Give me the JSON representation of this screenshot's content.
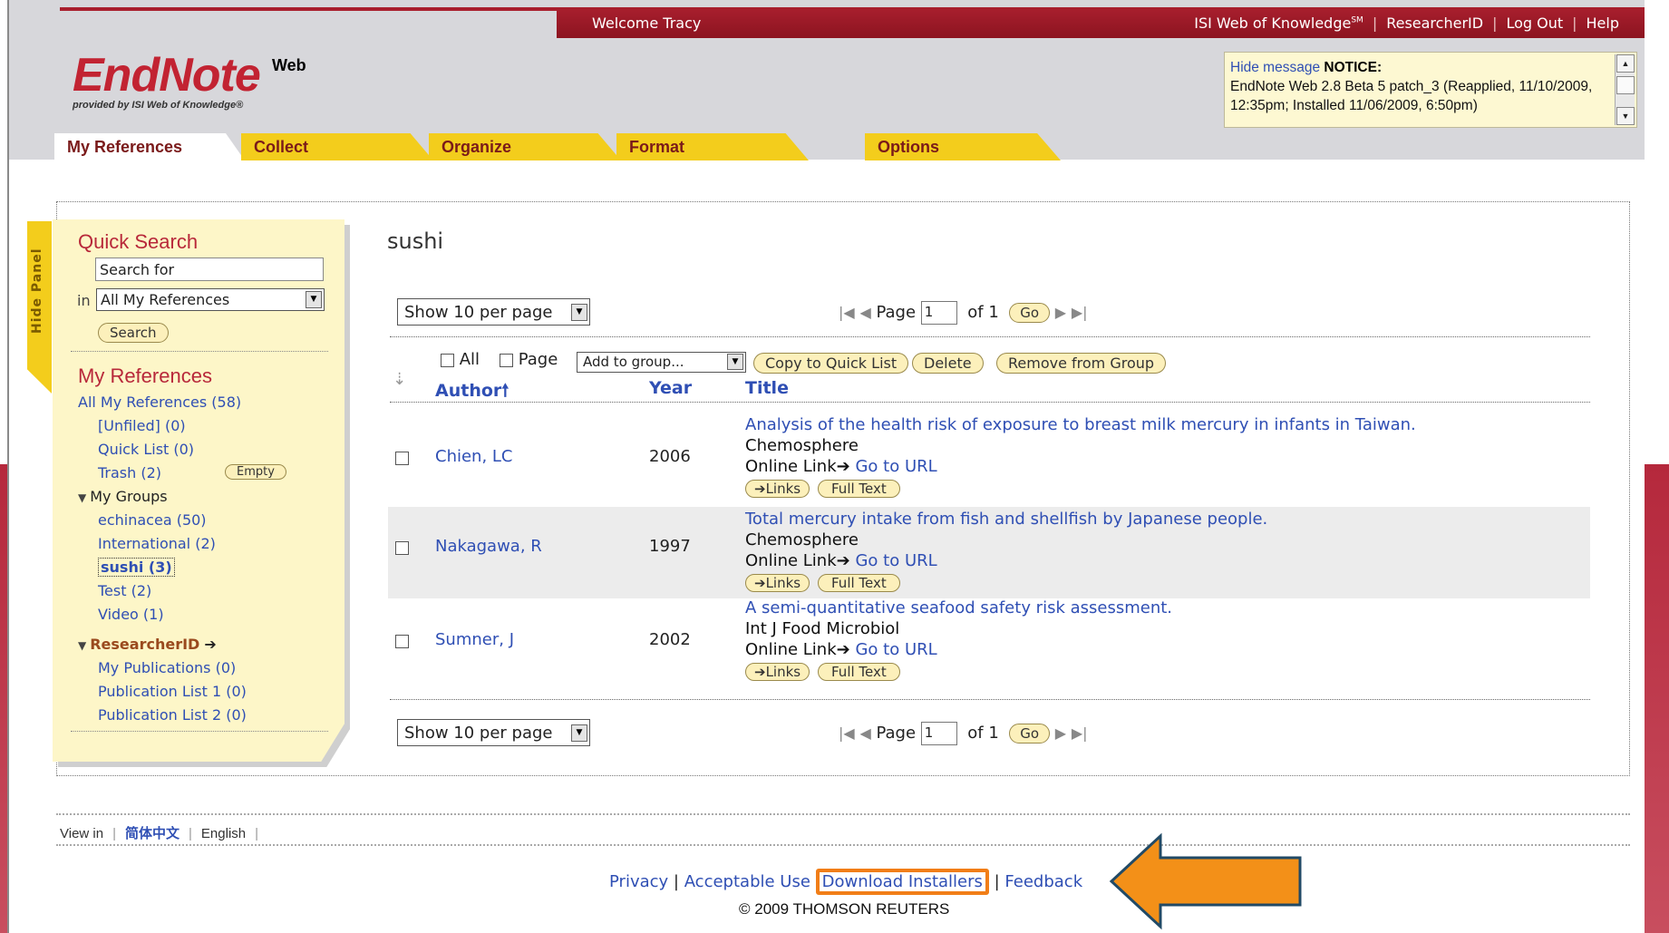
{
  "topbar": {
    "welcome": "Welcome Tracy",
    "links": [
      "ISI Web of Knowledge",
      "ResearcherID",
      "Log Out",
      "Help"
    ],
    "sm": "SM"
  },
  "logo": {
    "main": "EndNote",
    "web": "Web",
    "sub": "provided by ISI Web of Knowledge®"
  },
  "notice": {
    "hide": "Hide message",
    "label": "NOTICE:",
    "text": "EndNote Web 2.8 Beta 5 patch_3 (Reapplied, 11/10/2009, 12:35pm; Installed 11/06/2009, 6:50pm)"
  },
  "tabs": [
    "My References",
    "Collect",
    "Organize",
    "Format",
    "Options"
  ],
  "hide_panel": "Hide Panel",
  "sidebar": {
    "quick_search_title": "Quick Search",
    "search_placeholder": "Search for",
    "in_label": "in",
    "scope": "All My References",
    "search_button": "Search",
    "my_refs_title": "My References",
    "all_refs": "All My References (58)",
    "unfiled": "[Unfiled] (0)",
    "quick_list": "Quick List (0)",
    "trash": "Trash (2)",
    "empty_button": "Empty",
    "my_groups": "My Groups",
    "groups": [
      "echinacea (50)",
      "International (2)",
      "sushi (3)",
      "Test (2)",
      "Video (1)"
    ],
    "researcherid": "ResearcherID",
    "rid_items": [
      "My Publications (0)",
      "Publication List 1 (0)",
      "Publication List 2 (0)"
    ]
  },
  "content": {
    "group_title": "sushi",
    "per_page": "Show 10 per page",
    "page_label": "Page",
    "page_value": "1",
    "of_label": "of 1",
    "go": "Go",
    "all": "All",
    "page": "Page",
    "add_to_group": "Add to group...",
    "copy_button": "Copy to Quick List",
    "delete_button": "Delete",
    "remove_button": "Remove from Group",
    "col_author": "Author",
    "col_year": "Year",
    "col_title": "Title",
    "online_link": "Online Link",
    "go_to_url": "Go to URL",
    "links_button": "Links",
    "fulltext_button": "Full Text",
    "rows": [
      {
        "author": "Chien, LC",
        "year": "2006",
        "title": "Analysis of the health risk of exposure to breast milk mercury in infants in Taiwan.",
        "journal": "Chemosphere"
      },
      {
        "author": "Nakagawa, R",
        "year": "1997",
        "title": "Total mercury intake from fish and shellfish by Japanese people.",
        "journal": "Chemosphere"
      },
      {
        "author": "Sumner, J",
        "year": "2002",
        "title": "A semi-quantitative seafood safety risk assessment.",
        "journal": "Int J Food Microbiol"
      }
    ]
  },
  "footer": {
    "view_in": "View in",
    "lang_zh": "简体中文",
    "lang_en": "English",
    "privacy": "Privacy",
    "acceptable_use": "Acceptable Use",
    "download": "Download Installers",
    "feedback": "Feedback",
    "copyright": "© 2009 THOMSON REUTERS"
  },
  "colors": {
    "brand_red": "#a91f2e",
    "tab_yellow": "#f3cd1c",
    "link_blue": "#2f4fb4",
    "highlight_orange": "#f17e18"
  }
}
